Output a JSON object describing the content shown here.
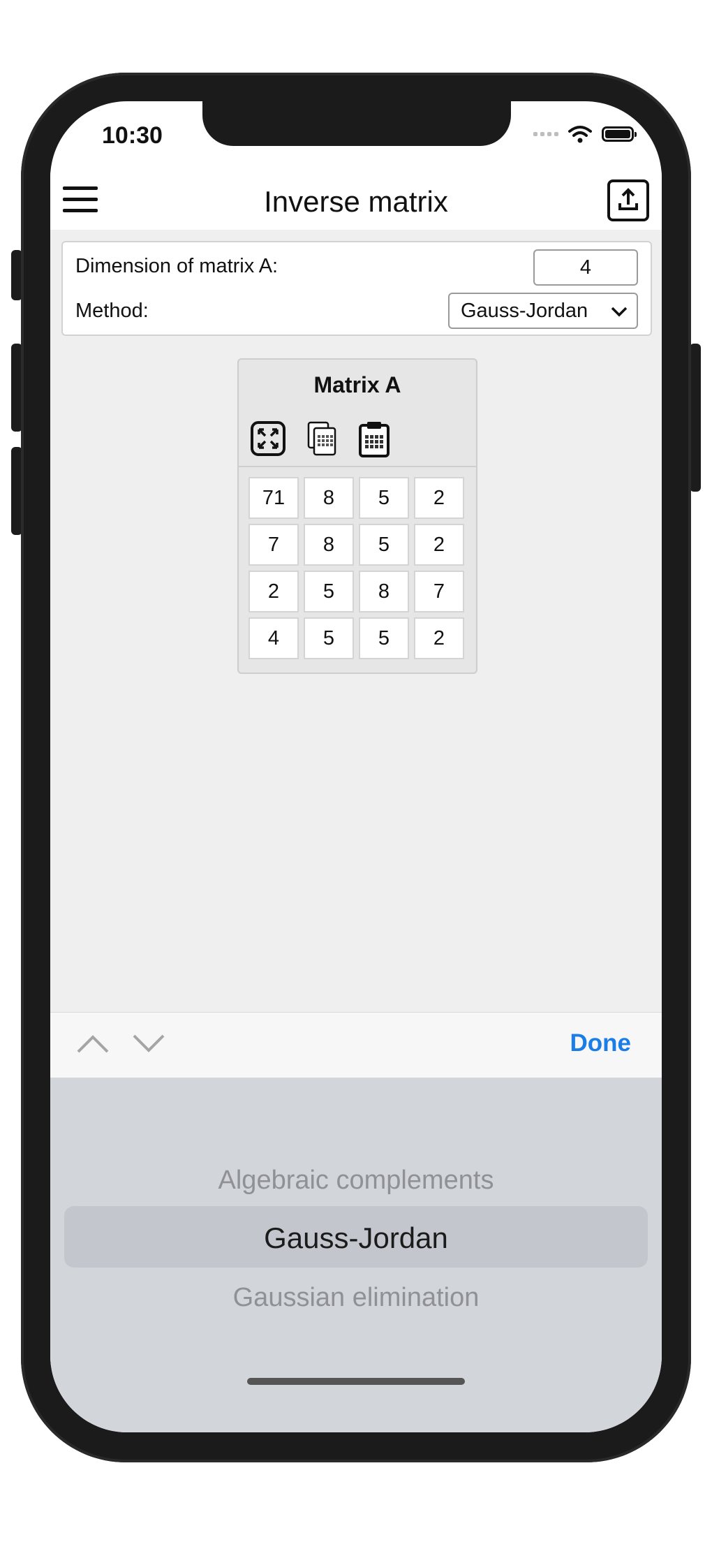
{
  "status": {
    "time": "10:30"
  },
  "nav": {
    "title": "Inverse matrix"
  },
  "settings": {
    "dimension_label": "Dimension of matrix A:",
    "dimension_value": "4",
    "method_label": "Method:",
    "method_value": "Gauss-Jordan"
  },
  "matrix": {
    "title": "Matrix A",
    "rows": [
      [
        "71",
        "8",
        "5",
        "2"
      ],
      [
        "7",
        "8",
        "5",
        "2"
      ],
      [
        "2",
        "5",
        "8",
        "7"
      ],
      [
        "4",
        "5",
        "5",
        "2"
      ]
    ]
  },
  "accessory": {
    "done_label": "Done"
  },
  "picker": {
    "options": [
      "Algebraic complements",
      "Gauss-Jordan",
      "Gaussian elimination"
    ],
    "selected_index": 1
  },
  "colors": {
    "accent": "#1a7ee6"
  }
}
